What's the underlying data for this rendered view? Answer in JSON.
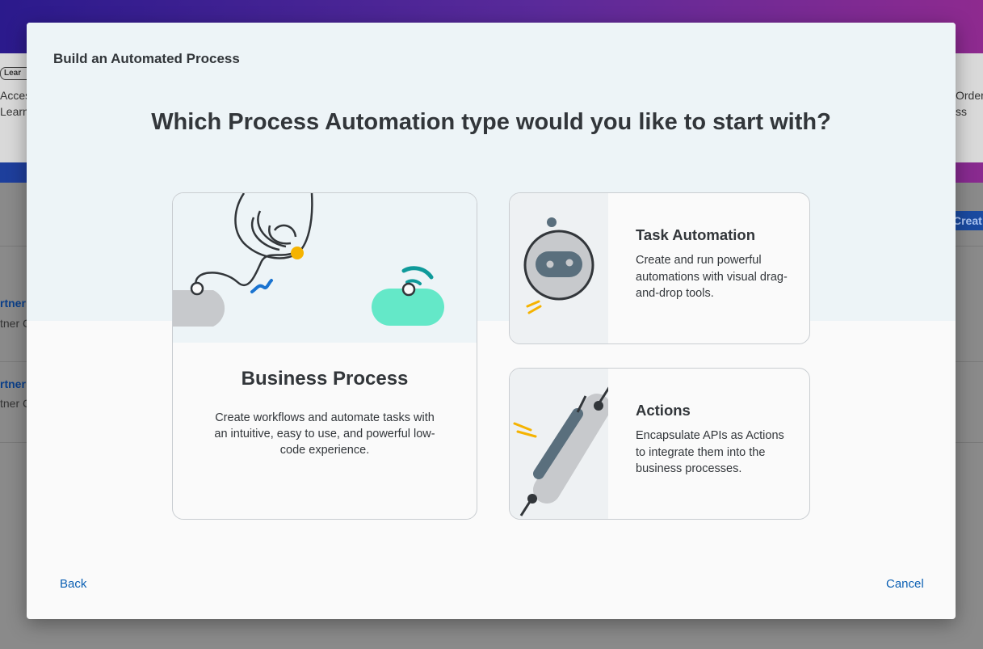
{
  "background": {
    "pill": "Lear",
    "left_texts": [
      "Acces",
      "Learn"
    ],
    "right_texts": [
      "Order",
      "ss"
    ],
    "create_button": "Creat",
    "rows": [
      {
        "link": "rtner",
        "sub": "tner C"
      },
      {
        "link": "rtner",
        "sub": "tner C"
      }
    ]
  },
  "dialog": {
    "title": "Build an Automated Process",
    "question": "Which Process Automation type would you like to start with?",
    "cards": {
      "business_process": {
        "title": "Business Process",
        "description": "Create workflows and automate tasks with an intuitive, easy to use, and powerful low-code experience."
      },
      "task_automation": {
        "title": "Task Automation",
        "description": "Create and run powerful automations with visual drag-and-drop tools."
      },
      "actions": {
        "title": "Actions",
        "description": "Encapsulate APIs as Actions to integrate them into the business processes."
      }
    },
    "footer": {
      "back_label": "Back",
      "cancel_label": "Cancel"
    }
  },
  "colors": {
    "accent_link": "#0a5fb3",
    "illustration_mint": "#64e8c8",
    "illustration_teal": "#0f9a9a",
    "illustration_yellow": "#f5b301",
    "illustration_blue": "#1a73d0"
  }
}
